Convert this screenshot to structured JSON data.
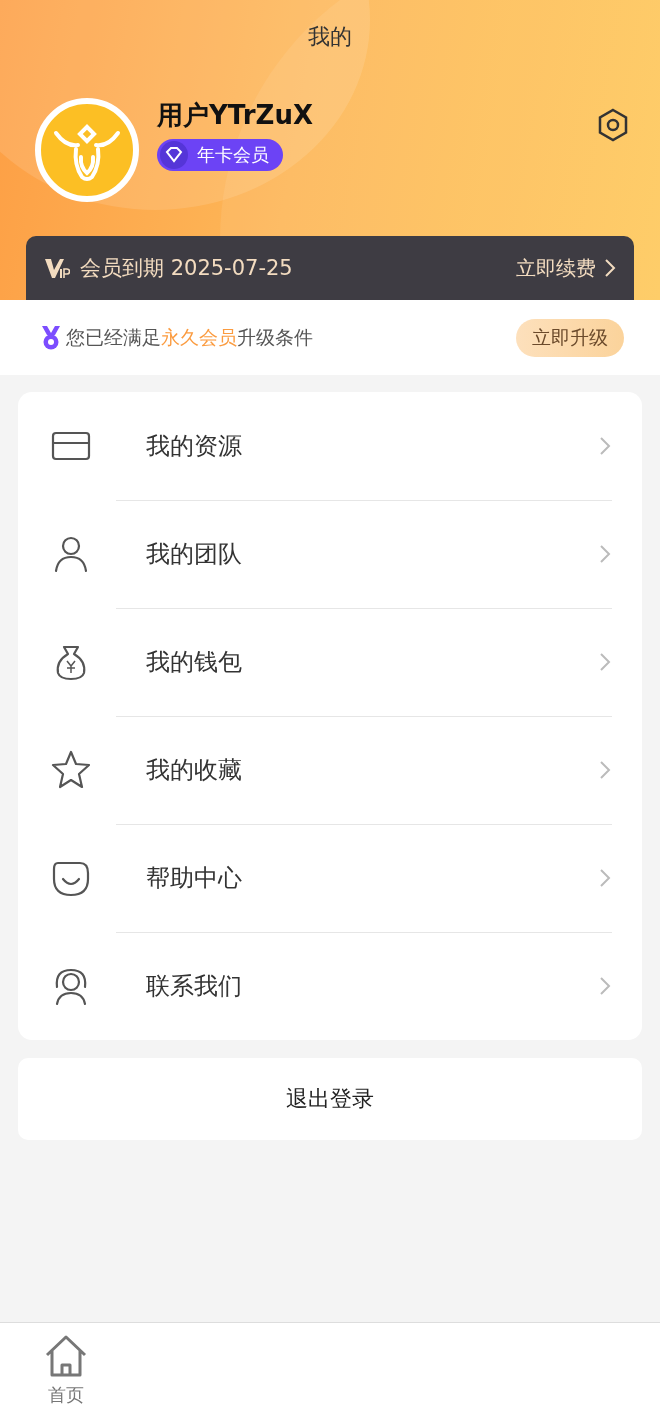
{
  "header": {
    "title": "我的"
  },
  "profile": {
    "username": "用户YTrZuX",
    "badge": "年卡会员"
  },
  "vip_bar": {
    "expiry": "会员到期 2025-07-25",
    "action": "立即续费"
  },
  "upgrade": {
    "before": "您已经满足",
    "highlight": "永久会员",
    "after": "升级条件",
    "button": "立即升级"
  },
  "menu": [
    {
      "kind": "card",
      "label": "我的资源"
    },
    {
      "kind": "person",
      "label": "我的团队"
    },
    {
      "kind": "bag",
      "label": "我的钱包"
    },
    {
      "kind": "star",
      "label": "我的收藏"
    },
    {
      "kind": "smile",
      "label": "帮助中心"
    },
    {
      "kind": "headset",
      "label": "联系我们"
    }
  ],
  "logout": "退出登录",
  "tab_bar": [
    {
      "kind": "home",
      "label": "首页",
      "selected": false
    }
  ]
}
